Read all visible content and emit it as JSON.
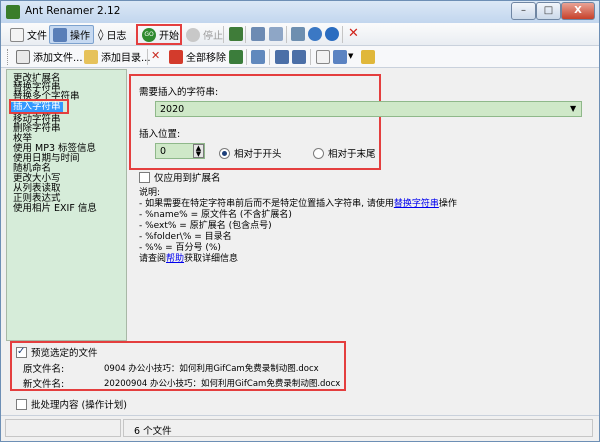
{
  "window": {
    "title": "Ant Renamer 2.12",
    "close_symbol": "X"
  },
  "toolbar1": {
    "file": "文件",
    "operations": "操作",
    "log": "日志",
    "start": "开始",
    "stop": "停止"
  },
  "toolbar2": {
    "add_files": "添加文件...",
    "add_folder": "添加目录...",
    "remove_all": "全部移除"
  },
  "actions": [
    "更改扩展名",
    "替换字符串",
    "替换多个字符串",
    "插入字符串",
    "移动字符串",
    "删除字符串",
    "枚举",
    "使用 MP3 标签信息",
    "使用日期与时间",
    "随机命名",
    "更改大小写",
    "从列表读取",
    "正则表达式",
    "使用相片 EXIF 信息"
  ],
  "selected_action_index": 3,
  "insert": {
    "string_label": "需要插入的字符串:",
    "string_value": "2020",
    "position_label": "插入位置:",
    "position_value": "0",
    "radio_start": "相对于开头",
    "radio_end": "相对于末尾",
    "radio_selected": "start"
  },
  "apply_ext_only": "仅应用到扩展名",
  "notes": {
    "heading": "说明:",
    "line1_a": "- 如果需要在特定字符串前后而不是特定位置插入字符串, 请使用",
    "line1_link": "替换字符串",
    "line1_b": "操作",
    "line2": "- %name% = 原文件名 (不含扩展名)",
    "line3": "- %ext% = 原扩展名 (包含点号)",
    "line4": "- %folder\\% = 目录名",
    "line5": "- %% = 百分号 (%)",
    "line6_a": "请查阅",
    "line6_link": "帮助",
    "line6_b": "获取详细信息"
  },
  "preview": {
    "checkbox_label": "预览选定的文件",
    "checked": true,
    "old_label": "原文件名:",
    "old_value": "0904   办公小技巧：如何利用GifCam免费录制动图.docx",
    "new_label": "新文件名:",
    "new_value": "20200904   办公小技巧：如何利用GifCam免费录制动图.docx"
  },
  "batch": {
    "label": "批处理内容 (操作计划)"
  },
  "status": {
    "file_count": "6 个文件"
  }
}
